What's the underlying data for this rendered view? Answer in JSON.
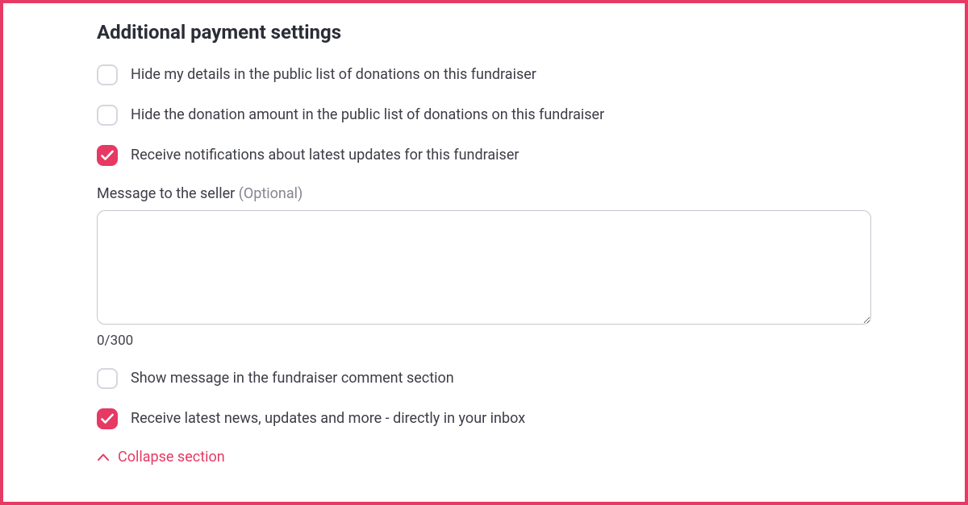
{
  "heading": "Additional payment settings",
  "checkboxes": {
    "hideDetails": {
      "label": "Hide my details in the public list of donations on this fundraiser"
    },
    "hideAmount": {
      "label": "Hide the donation amount in the public list of donations on this fundraiser"
    },
    "notifications": {
      "label": "Receive notifications about latest updates for this fundraiser"
    },
    "showMessage": {
      "label": "Show message in the fundraiser comment section"
    },
    "newsletter": {
      "label": "Receive latest news, updates and more - directly in your inbox"
    }
  },
  "messageField": {
    "label": "Message to the seller",
    "optional": "(Optional)",
    "value": "",
    "charCount": "0/300"
  },
  "collapse": {
    "label": "Collapse section"
  },
  "colors": {
    "accent": "#e63963"
  }
}
